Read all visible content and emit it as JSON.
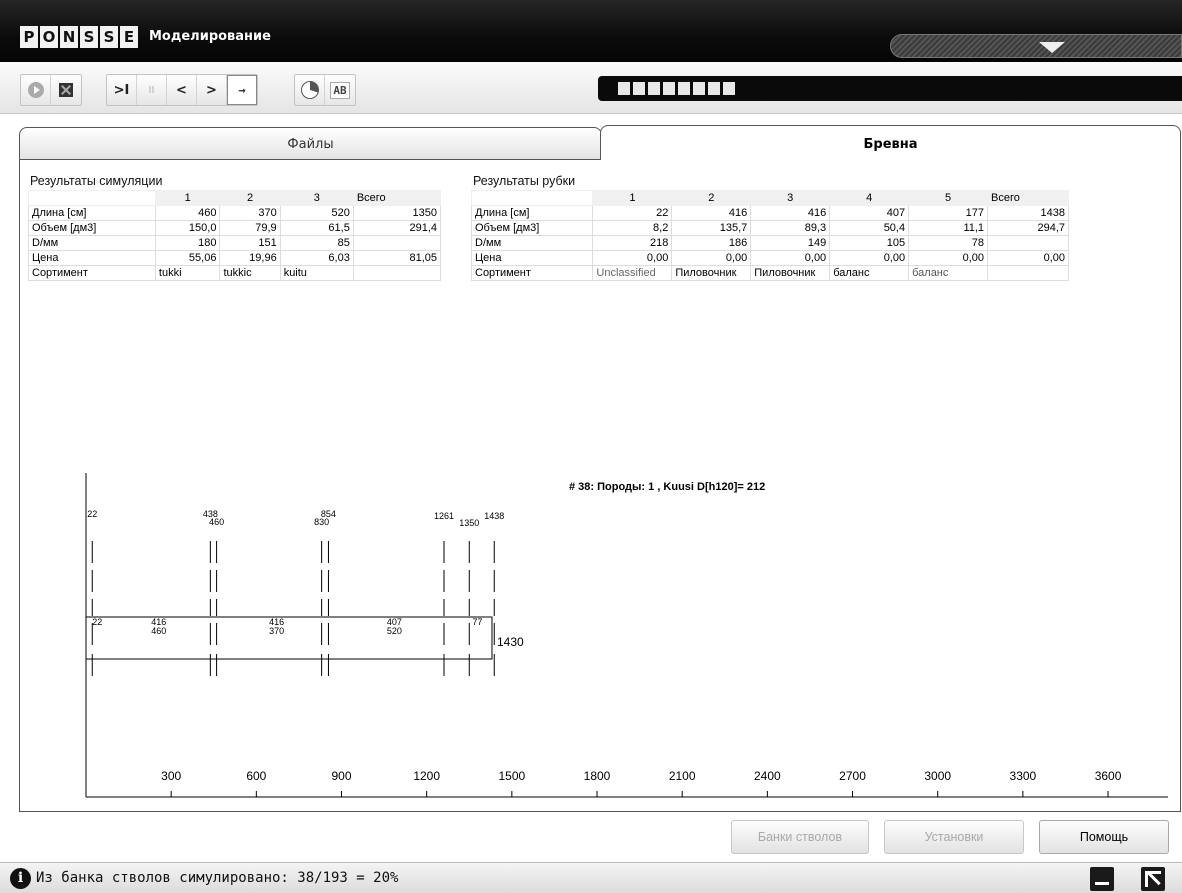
{
  "app": {
    "logo_letters": [
      "P",
      "O",
      "N",
      "S",
      "S",
      "E"
    ],
    "title": "Моделирование"
  },
  "toolbar": {
    "icons": [
      "play-icon",
      "stop-icon",
      "skip-to-end-icon",
      "pause-icon",
      "previous-icon",
      "next-icon",
      "continuous-icon",
      "pie-chart-icon",
      "text-ab-icon"
    ],
    "skip_glyph": ">I",
    "pause_glyph": "II",
    "prev_glyph": "<",
    "next_glyph": ">",
    "continuous_glyph": "→",
    "ab_glyph": "AB"
  },
  "progress": {
    "segments": 8
  },
  "tabs": [
    {
      "label": "Файлы",
      "active": false
    },
    {
      "label": "Бревна",
      "active": true
    }
  ],
  "simulation": {
    "title": "Результаты симуляции",
    "columns": [
      "1",
      "2",
      "3",
      "Всего"
    ],
    "rows": [
      {
        "label": "Длина [см]",
        "values": [
          "460",
          "370",
          "520",
          "1350"
        ]
      },
      {
        "label": "Объем [дм3]",
        "values": [
          "150,0",
          "79,9",
          "61,5",
          "291,4"
        ]
      },
      {
        "label": "D/мм",
        "values": [
          "180",
          "151",
          "85",
          ""
        ]
      },
      {
        "label": "Цена",
        "values": [
          "55,06",
          "19,96",
          "6,03",
          "81,05"
        ]
      },
      {
        "label": "Сортимент",
        "values": [
          "tukki",
          "tukkic",
          "kuitu",
          ""
        ]
      }
    ]
  },
  "felling": {
    "title": "Результаты рубки",
    "columns": [
      "1",
      "2",
      "3",
      "4",
      "5",
      "Всего"
    ],
    "rows": [
      {
        "label": "Длина [см]",
        "values": [
          "22",
          "416",
          "416",
          "407",
          "177",
          "1438"
        ]
      },
      {
        "label": "Объем [дм3]",
        "values": [
          "8,2",
          "135,7",
          "89,3",
          "50,4",
          "11,1",
          "294,7"
        ]
      },
      {
        "label": "D/мм",
        "values": [
          "218",
          "186",
          "149",
          "105",
          "78",
          ""
        ]
      },
      {
        "label": "Цена",
        "values": [
          "0,00",
          "0,00",
          "0,00",
          "0,00",
          "0,00",
          "0,00"
        ]
      },
      {
        "label": "Сортимент",
        "values": [
          "Unclassified",
          "Пиловочник",
          "Пиловочник",
          "баланс",
          "баланс",
          ""
        ]
      }
    ]
  },
  "chart_data": {
    "type": "diagram",
    "title": "# 38: Породы: 1 , Kuusi   D[h120]= 212",
    "x_ticks": [
      300,
      600,
      900,
      1200,
      1500,
      1800,
      2100,
      2400,
      2700,
      3000,
      3300,
      3600
    ],
    "felling_cuts": [
      22,
      438,
      854,
      1261,
      1438
    ],
    "sim_cuts": [
      460,
      830,
      1350
    ],
    "top_labels": [
      {
        "text": "22",
        "x": 22
      },
      {
        "text": "438",
        "x": 438
      },
      {
        "text": "460",
        "x": 460
      },
      {
        "text": "854",
        "x": 854
      },
      {
        "text": "830",
        "x": 830
      },
      {
        "text": "1261",
        "x": 1261
      },
      {
        "text": "1350",
        "x": 1350
      },
      {
        "text": "1438",
        "x": 1438
      }
    ],
    "log_labels": [
      {
        "felling": "22",
        "sim": "",
        "x": 22
      },
      {
        "felling": "416",
        "sim": "460",
        "x": 230
      },
      {
        "felling": "416",
        "sim": "370",
        "x": 645
      },
      {
        "felling": "407",
        "sim": "520",
        "x": 1060
      },
      {
        "felling": "77",
        "sim": "",
        "x": 1361
      }
    ],
    "stem_length": 1430,
    "stem_end_x": 1430,
    "stem_length_label": "1430"
  },
  "buttons": {
    "stem_banks": "Банки стволов",
    "settings": "Установки",
    "help": "Помощь"
  },
  "status": {
    "text": "Из банка стволов симулировано:  38/193 = 20%"
  }
}
